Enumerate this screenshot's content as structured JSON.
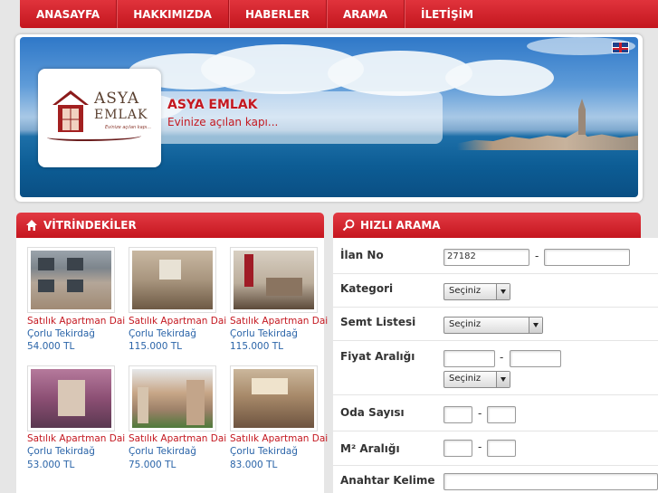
{
  "nav": {
    "items": [
      "ANASAYFA",
      "HAKKIMIZDA",
      "HABERLER",
      "ARAMA",
      "İLETİŞİM"
    ]
  },
  "banner": {
    "logo_line1": "ASYA",
    "logo_line2": "EMLAK",
    "logo_slogan": "Evinize açılan kapı...",
    "title": "ASYA EMLAK",
    "subtitle": "Evinize açılan kapı..."
  },
  "vitrin": {
    "heading": "VİTRİNDEKİLER",
    "listings": [
      {
        "title": "Satılık Apartman Dai",
        "location": "Çorlu Tekirdağ",
        "price": "54.000 TL"
      },
      {
        "title": "Satılık Apartman Dai",
        "location": "Çorlu Tekirdağ",
        "price": "115.000 TL"
      },
      {
        "title": "Satılık Apartman Dai",
        "location": "Çorlu Tekirdağ",
        "price": "115.000 TL"
      },
      {
        "title": "Satılık Apartman Dai",
        "location": "Çorlu Tekirdağ",
        "price": "53.000 TL"
      },
      {
        "title": "Satılık Apartman Dai",
        "location": "Çorlu Tekirdağ",
        "price": "75.000 TL"
      },
      {
        "title": "Satılık Apartman Dai",
        "location": "Çorlu Tekirdağ",
        "price": "83.000 TL"
      }
    ]
  },
  "search": {
    "heading": "HIZLI ARAMA",
    "ilan_no_label": "İlan No",
    "ilan_no_value": "27182",
    "kategori_label": "Kategori",
    "kategori_value": "Seçiniz",
    "semt_label": "Semt Listesi",
    "semt_value": "Seçiniz",
    "fiyat_label": "Fiyat Aralığı",
    "fiyat_currency_value": "Seçiniz",
    "oda_label": "Oda Sayısı",
    "m2_label": "M² Aralığı",
    "anahtar_label": "Anahtar Kelime",
    "dash": "-"
  },
  "colors": {
    "brand_red": "#c5161f",
    "link_blue": "#2a64a8"
  },
  "icons": {
    "vitrin": "home-icon",
    "search": "magnifier-icon",
    "language": "uk-flag-icon"
  }
}
